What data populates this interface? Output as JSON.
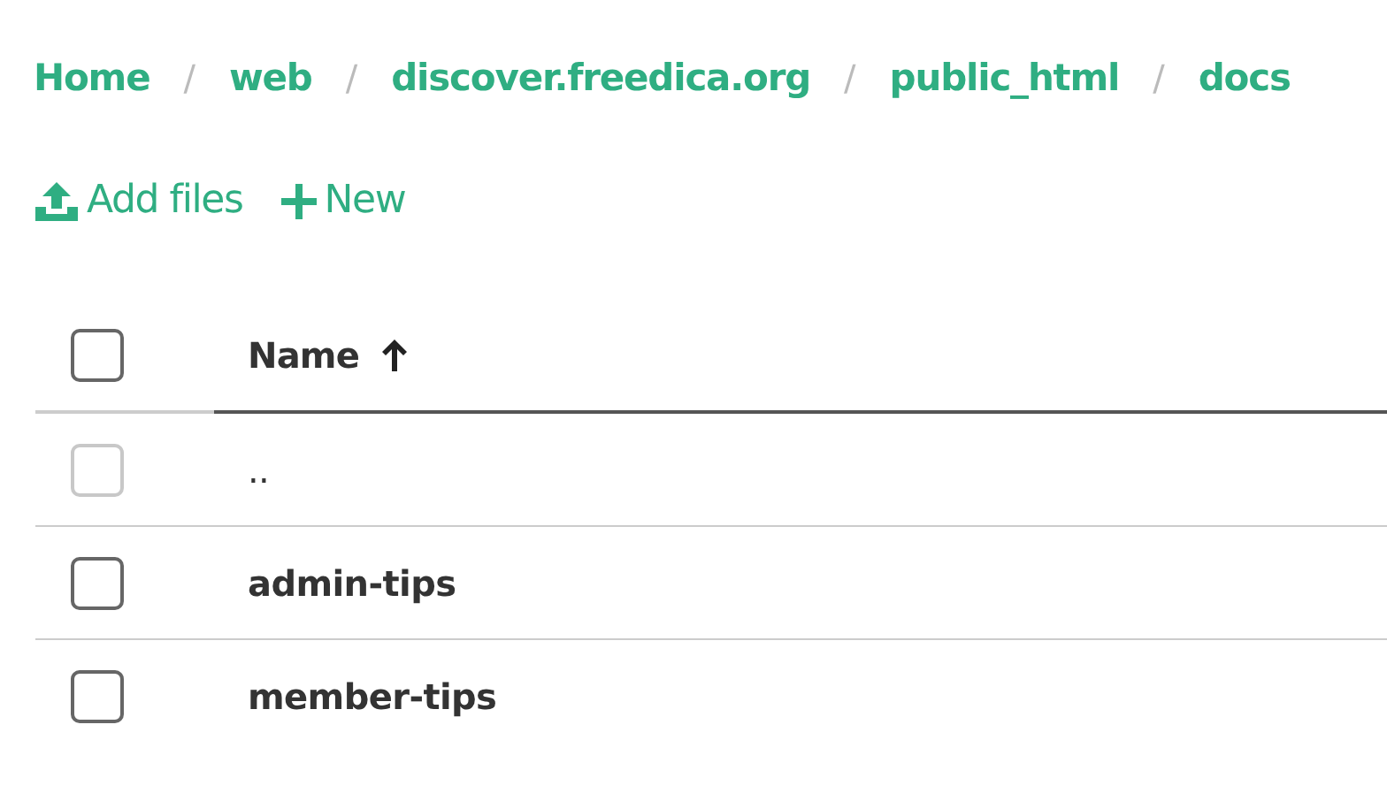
{
  "breadcrumb": [
    {
      "kind": "link",
      "text": "Home"
    },
    {
      "kind": "separator",
      "text": "/"
    },
    {
      "kind": "link",
      "text": "web"
    },
    {
      "kind": "separator",
      "text": "/"
    },
    {
      "kind": "link",
      "text": "discover.freedica.org"
    },
    {
      "kind": "separator",
      "text": "/"
    },
    {
      "kind": "link",
      "text": "public_html"
    },
    {
      "kind": "separator",
      "text": "/"
    },
    {
      "kind": "link",
      "text": "docs"
    }
  ],
  "toolbar": [
    {
      "kind": "upload",
      "label": "Add files"
    },
    {
      "kind": "add",
      "label": "New"
    }
  ],
  "table": {
    "select_all": {
      "checked": false
    },
    "columns": [
      {
        "label": "Name",
        "sort_ascending": true
      }
    ],
    "rows": [
      {
        "kind": "parent",
        "name": "..",
        "checked": false,
        "disabled": true
      },
      {
        "kind": "folder",
        "name": "admin-tips",
        "checked": false,
        "disabled": false
      },
      {
        "kind": "folder",
        "name": "member-tips",
        "checked": false,
        "disabled": false
      }
    ]
  }
}
